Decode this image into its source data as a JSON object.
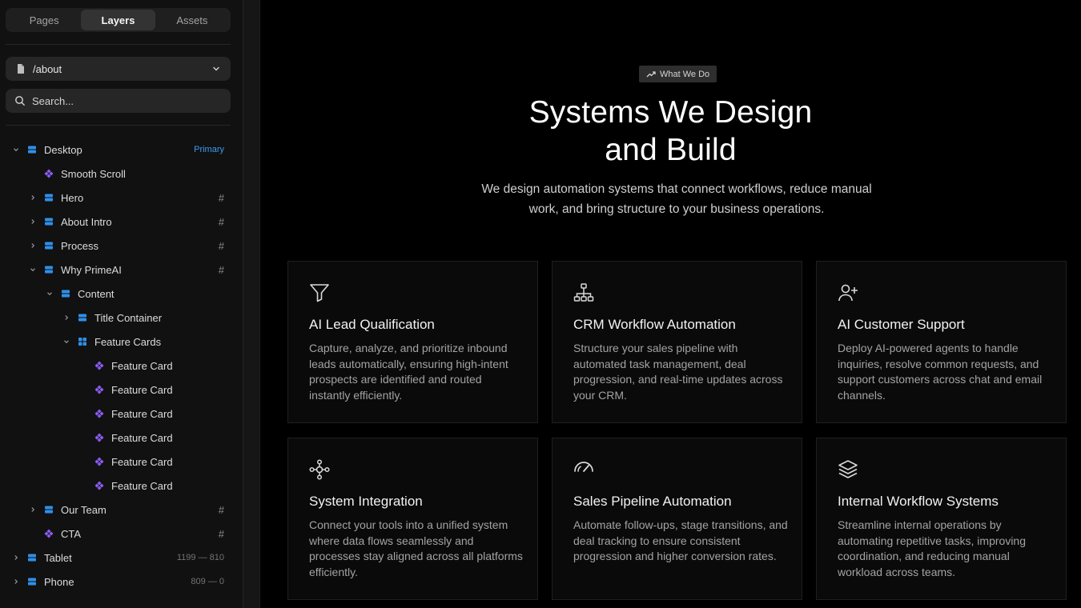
{
  "sidebar": {
    "tabs": [
      {
        "label": "Pages"
      },
      {
        "label": "Layers"
      },
      {
        "label": "Assets"
      }
    ],
    "page_select": {
      "value": "/about"
    },
    "search": {
      "placeholder": "Search..."
    },
    "layers": [
      {
        "name": "Desktop",
        "meta": "Primary"
      },
      {
        "name": "Smooth Scroll"
      },
      {
        "name": "Hero",
        "meta": "#"
      },
      {
        "name": "About Intro",
        "meta": "#"
      },
      {
        "name": "Process",
        "meta": "#"
      },
      {
        "name": "Why PrimeAI",
        "meta": "#"
      },
      {
        "name": "Content"
      },
      {
        "name": "Title Container"
      },
      {
        "name": "Feature Cards"
      },
      {
        "name": "Feature Card"
      },
      {
        "name": "Feature Card"
      },
      {
        "name": "Feature Card"
      },
      {
        "name": "Feature Card"
      },
      {
        "name": "Feature Card"
      },
      {
        "name": "Feature Card"
      },
      {
        "name": "Our Team",
        "meta": "#"
      },
      {
        "name": "CTA",
        "meta": "#"
      },
      {
        "name": "Tablet",
        "meta": "1199 — 810"
      },
      {
        "name": "Phone",
        "meta": "809 — 0"
      }
    ]
  },
  "canvas": {
    "badge": "What We Do",
    "headline_line1": "Systems We Design",
    "headline_line2": "and Build",
    "subhead_line1": "We design automation systems that connect workflows, reduce manual",
    "subhead_line2": "work, and bring structure to your business operations.",
    "cards": [
      {
        "icon": "filter-icon",
        "title": "AI Lead Qualification",
        "desc": "Capture, analyze, and prioritize inbound leads automatically, ensuring high-intent prospects are identified and routed instantly efficiently."
      },
      {
        "icon": "sitemap-icon",
        "title": "CRM Workflow Automation",
        "desc": "Structure your sales pipeline with automated task management, deal progression, and real-time updates across your CRM."
      },
      {
        "icon": "user-plus-icon",
        "title": "AI Customer Support",
        "desc": "Deploy AI-powered agents to handle inquiries, resolve common requests, and support customers across chat and email channels."
      },
      {
        "icon": "integration-icon",
        "title": "System Integration",
        "desc": "Connect your tools into a unified system where data flows seamlessly and processes stay aligned across all platforms efficiently."
      },
      {
        "icon": "gauge-icon",
        "title": "Sales Pipeline Automation",
        "desc": "Automate follow-ups, stage transitions, and deal tracking to ensure consistent progression and higher conversion rates."
      },
      {
        "icon": "layers-icon",
        "title": "Internal Workflow Systems",
        "desc": "Streamline internal operations by automating repetitive tasks, improving coordination, and reducing manual workload across teams."
      }
    ]
  },
  "colors": {
    "accent_blue": "#3b9cf0",
    "component_purple": "#8b5cf6",
    "frame_blue": "#2f8fe8",
    "background": "#000000",
    "sidebar": "#111111"
  }
}
